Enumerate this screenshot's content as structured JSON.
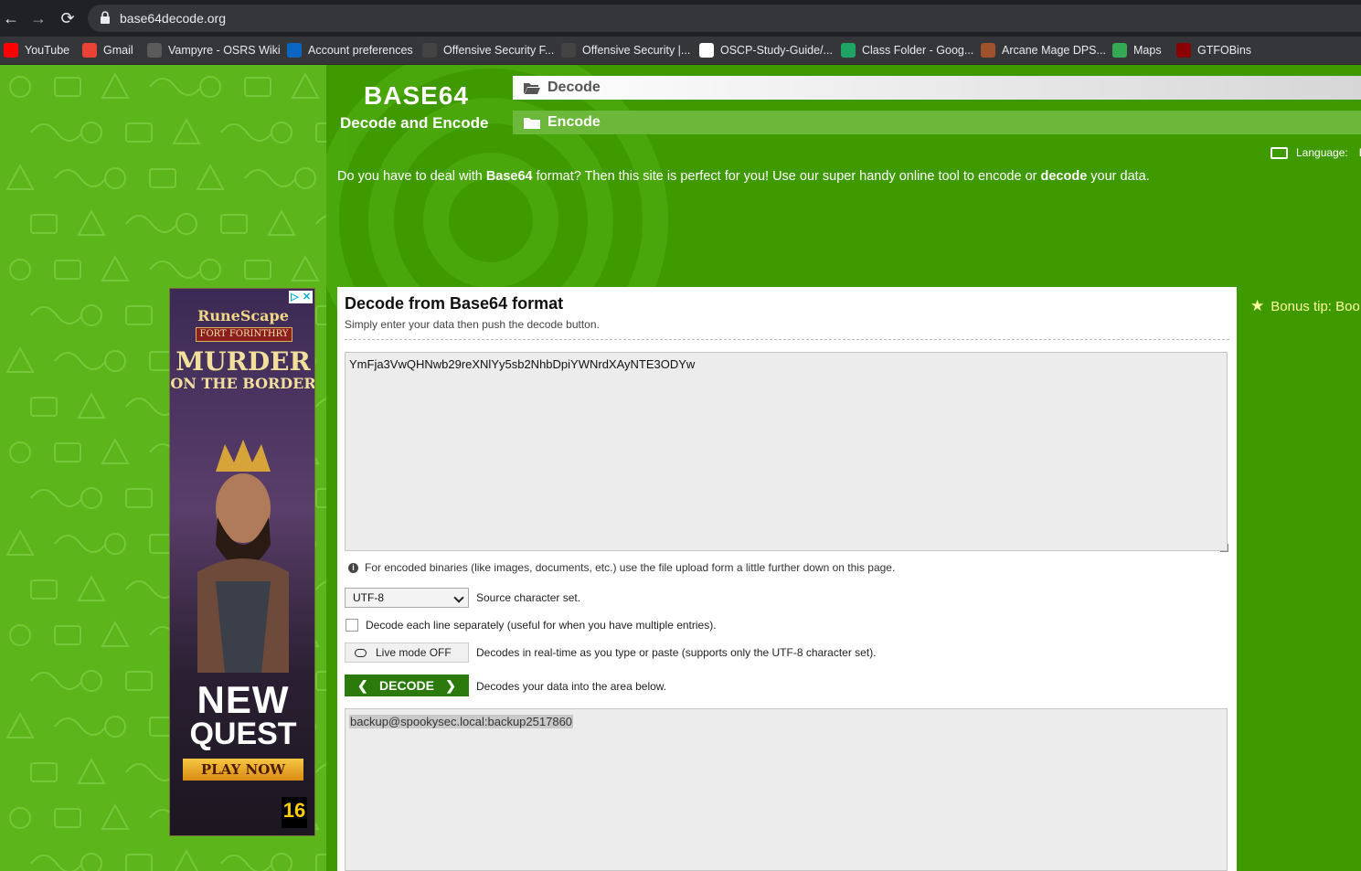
{
  "browser": {
    "url": "base64decode.org",
    "nav": {
      "back": "←",
      "forward": "→",
      "reload": "⟳"
    },
    "bookmarks": [
      {
        "label": "YouTube",
        "icon": "youtube-icon",
        "color": "#ff0000"
      },
      {
        "label": "Gmail",
        "icon": "gmail-icon",
        "color": "#ea4335"
      },
      {
        "label": "Vampyre - OSRS Wiki",
        "icon": "osrs-wiki-icon",
        "color": "#5a5a5a"
      },
      {
        "label": "Account preferences",
        "icon": "linkedin-icon",
        "color": "#0a66c2"
      },
      {
        "label": "Offensive Security F...",
        "icon": "offsec-icon",
        "color": "#444444"
      },
      {
        "label": "Offensive Security |...",
        "icon": "offsec-icon",
        "color": "#444444"
      },
      {
        "label": "OSCP-Study-Guide/...",
        "icon": "github-icon",
        "color": "#ffffff"
      },
      {
        "label": "Class Folder - Goog...",
        "icon": "google-drive-icon",
        "color": "#1fa463"
      },
      {
        "label": "Arcane Mage DPS...",
        "icon": "wow-icon",
        "color": "#a0522d"
      },
      {
        "label": "Maps",
        "icon": "google-maps-icon",
        "color": "#34a853"
      },
      {
        "label": "GTFOBins",
        "icon": "gtfobins-icon",
        "color": "#8b0000"
      }
    ]
  },
  "site": {
    "brand_title": "BASE64",
    "brand_sub": "Decode and Encode",
    "tabs": {
      "decode": "Decode",
      "encode": "Encode"
    },
    "language_label": "Language:",
    "language_value": "E",
    "intro": {
      "p1": "Do you have to deal with ",
      "b1": "Base64",
      "p2": " format? Then this site is perfect for you! Use our super handy online tool to encode or ",
      "b2": "decode",
      "p3": " your data."
    },
    "bonus": "Bonus tip: Boo"
  },
  "ad": {
    "logo": "RuneScape",
    "sub": "FORT FORINTHRY",
    "line1": "MURDER",
    "line2": "ON THE BORDER",
    "new": "NEW",
    "quest": "QUEST",
    "play": "PLAY NOW",
    "rating": "16",
    "close_icons": [
      "▷",
      "✕"
    ]
  },
  "decoder": {
    "title": "Decode from Base64 format",
    "subtitle": "Simply enter your data then push the decode button.",
    "input_value": "YmFja3VwQHNwb29reXNlYy5sb2NhbDpiYWNrdXAyNTE3ODYw",
    "binary_note": "For encoded binaries (like images, documents, etc.) use the file upload form a little further down on this page.",
    "charset_value": "UTF-8",
    "charset_label": "Source character set.",
    "each_line_label": "Decode each line separately (useful for when you have multiple entries).",
    "live_mode_label": "Live mode OFF",
    "live_mode_desc": "Decodes in real-time as you type or paste (supports only the UTF-8 character set).",
    "decode_button": "DECODE",
    "decode_desc": "Decodes your data into the area below.",
    "output_value": "backup@spookysec.local:backup2517860"
  }
}
